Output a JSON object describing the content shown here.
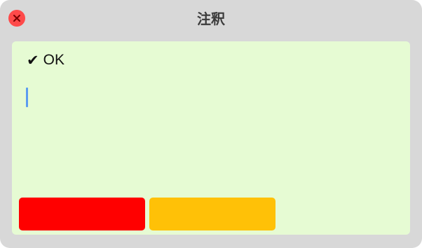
{
  "window": {
    "title": "注釈"
  },
  "note": {
    "status_label": "OK",
    "status_icon": "checkmark-icon",
    "input_value": "",
    "background_color": "#e6fbd3"
  },
  "color_swatches": [
    {
      "color": "#ff0000"
    },
    {
      "color": "#ffc107"
    }
  ],
  "colors": {
    "close_button": "#fe4a4a",
    "caret": "#5c9cf0",
    "window_chrome": "#d8d8d8"
  }
}
